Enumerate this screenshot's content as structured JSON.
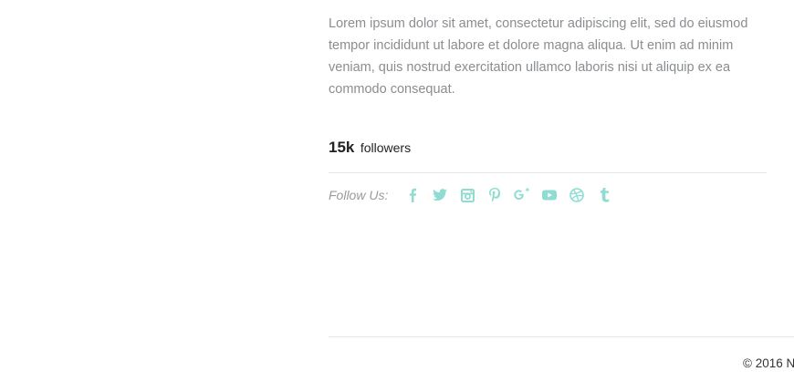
{
  "profile": {
    "bio": "Lorem ipsum dolor sit amet, consectetur adipiscing elit, sed do eiusmod tempor incididunt ut labore et dolore magna aliqua. Ut enim ad minim veniam, quis nostrud exercitation ullamco laboris nisi ut aliquip ex ea commodo consequat.",
    "followers_count": "15k",
    "followers_label": "followers"
  },
  "social": {
    "label": "Follow Us:",
    "icon_color": "#8fddd2",
    "icons": [
      "facebook-icon",
      "twitter-icon",
      "instagram-icon",
      "pinterest-icon",
      "google-plus-icon",
      "youtube-icon",
      "dribbble-icon",
      "tumblr-icon"
    ]
  },
  "footer": {
    "copyright": "© 2016 N"
  }
}
